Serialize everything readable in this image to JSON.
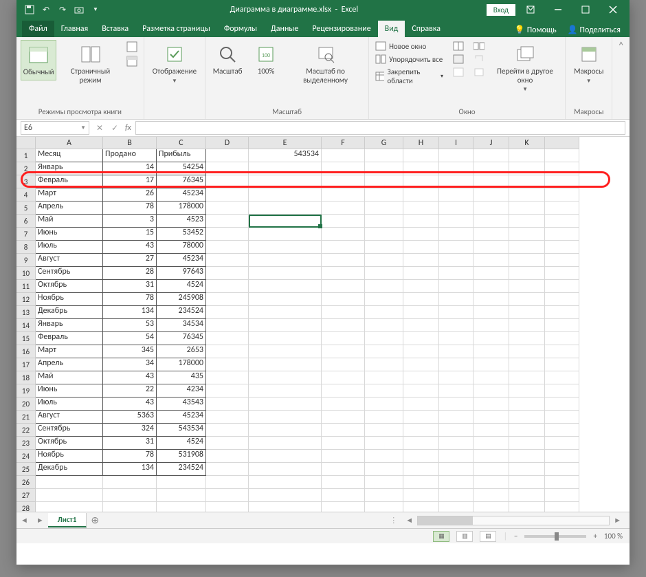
{
  "title": {
    "filename": "Диаграмма в диаграмме.xlsx",
    "app": "Excel",
    "signin": "Вход"
  },
  "tabs": {
    "file": "Файл",
    "items": [
      "Главная",
      "Вставка",
      "Разметка страницы",
      "Формулы",
      "Данные",
      "Рецензирование",
      "Вид",
      "Справка"
    ],
    "extras": {
      "tellme": "Помощь",
      "share": "Поделиться"
    }
  },
  "ribbon": {
    "views": {
      "normal": "Обычный",
      "pagebreak": "Страничный режим",
      "pagelayout_tip": "Разметка страницы",
      "custom_tip": "Представления",
      "display": "Отображение",
      "group_label": "Режимы просмотра книги"
    },
    "zoom": {
      "zoom": "Масштаб",
      "hundred": "100%",
      "selection": "Масштаб по выделенному",
      "group_label": "Масштаб"
    },
    "window": {
      "newwin": "Новое окно",
      "arrange": "Упорядочить все",
      "freeze": "Закрепить области",
      "switch": "Перейти в другое окно",
      "group_label": "Окно"
    },
    "macros": {
      "label": "Макросы",
      "group_label": "Макросы"
    }
  },
  "namebox": {
    "ref": "E6",
    "fx": "fx"
  },
  "columns": [
    "A",
    "B",
    "C",
    "D",
    "E",
    "F",
    "G",
    "H",
    "I",
    "J",
    "K"
  ],
  "data": {
    "headers": {
      "a": "Месяц",
      "b": "Продано",
      "c": "Прибыль",
      "e": "543534"
    },
    "rows": [
      {
        "n": 2,
        "a": "Январь",
        "b": 14,
        "c": 54254
      },
      {
        "n": 3,
        "a": "Февраль",
        "b": 17,
        "c": 76345
      },
      {
        "n": 4,
        "a": "Март",
        "b": 26,
        "c": 45234
      },
      {
        "n": 5,
        "a": "Апрель",
        "b": 78,
        "c": 178000
      },
      {
        "n": 6,
        "a": "Май",
        "b": 3,
        "c": 4523
      },
      {
        "n": 7,
        "a": "Июнь",
        "b": 15,
        "c": 53452
      },
      {
        "n": 8,
        "a": "Июль",
        "b": 43,
        "c": 78000
      },
      {
        "n": 9,
        "a": "Август",
        "b": 27,
        "c": 45234
      },
      {
        "n": 10,
        "a": "Сентябрь",
        "b": 28,
        "c": 97643
      },
      {
        "n": 11,
        "a": "Октябрь",
        "b": 31,
        "c": 4524
      },
      {
        "n": 12,
        "a": "Ноябрь",
        "b": 78,
        "c": 245908
      },
      {
        "n": 13,
        "a": "Декабрь",
        "b": 134,
        "c": 234524
      },
      {
        "n": 14,
        "a": "Январь",
        "b": 53,
        "c": 34534
      },
      {
        "n": 15,
        "a": "Февраль",
        "b": 54,
        "c": 76345
      },
      {
        "n": 16,
        "a": "Март",
        "b": 345,
        "c": 2653
      },
      {
        "n": 17,
        "a": "Апрель",
        "b": 34,
        "c": 178000
      },
      {
        "n": 18,
        "a": "Май",
        "b": 43,
        "c": 435
      },
      {
        "n": 19,
        "a": "Июнь",
        "b": 22,
        "c": 4234
      },
      {
        "n": 20,
        "a": "Июль",
        "b": 43,
        "c": 43543
      },
      {
        "n": 21,
        "a": "Август",
        "b": 5363,
        "c": 45234
      },
      {
        "n": 22,
        "a": "Сентябрь",
        "b": 324,
        "c": 543534
      },
      {
        "n": 23,
        "a": "Октябрь",
        "b": 31,
        "c": 4524
      },
      {
        "n": 24,
        "a": "Ноябрь",
        "b": 78,
        "c": 531908
      },
      {
        "n": 25,
        "a": "Декабрь",
        "b": 134,
        "c": 234524
      }
    ]
  },
  "sheettab": "Лист1",
  "status": {
    "zoom": "100 %"
  }
}
